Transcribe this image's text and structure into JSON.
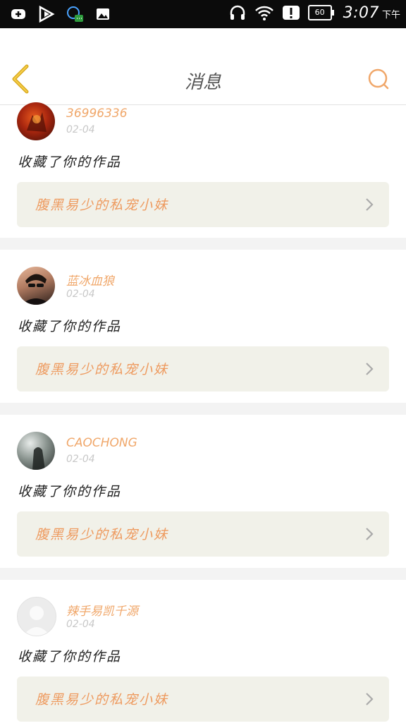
{
  "status_bar": {
    "time": "3:07",
    "ampm": "下午",
    "battery": "60"
  },
  "header": {
    "title": "消息"
  },
  "colors": {
    "accent": "#f0a76a",
    "back_arrow": "#e0b52a",
    "card_bg": "#f1f1e9"
  },
  "messages": [
    {
      "username": "36996336",
      "date": "02-04",
      "action": "收藏了你的作品",
      "work_title": "腹黑易少的私宠小妹"
    },
    {
      "username": "蓝冰血狼",
      "date": "02-04",
      "action": "收藏了你的作品",
      "work_title": "腹黑易少的私宠小妹"
    },
    {
      "username": "CAOCHONG",
      "date": "02-04",
      "action": "收藏了你的作品",
      "work_title": "腹黑易少的私宠小妹"
    },
    {
      "username": "辣手易凯千源",
      "date": "02-04",
      "action": "收藏了你的作品",
      "work_title": "腹黑易少的私宠小妹"
    }
  ]
}
